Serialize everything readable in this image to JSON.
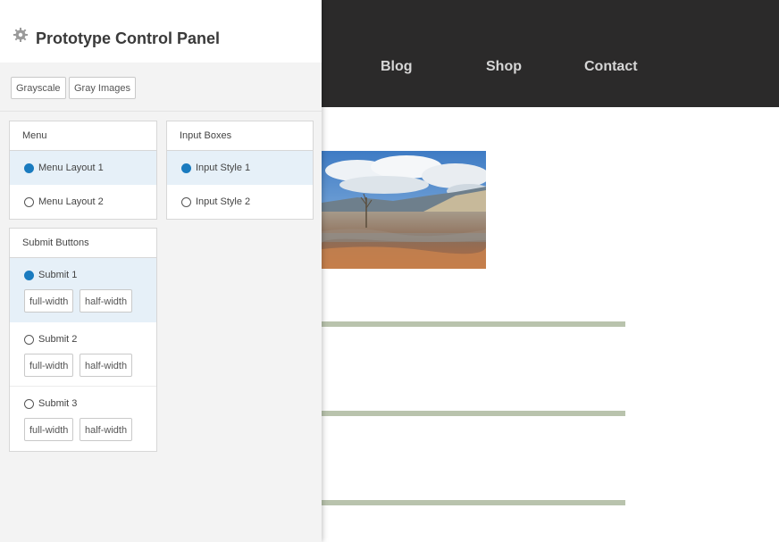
{
  "site": {
    "nav": [
      "Blog",
      "Shop",
      "Contact"
    ]
  },
  "panel": {
    "title": "Prototype Control Panel",
    "gear_icon": "gear-icon",
    "top_buttons": [
      "Grayscale",
      "Gray Images"
    ],
    "menu": {
      "heading": "Menu",
      "options": [
        "Menu Layout 1",
        "Menu Layout 2"
      ],
      "selected": 0
    },
    "input_boxes": {
      "heading": "Input Boxes",
      "options": [
        "Input Style 1",
        "Input Style 2"
      ],
      "selected": 0
    },
    "submit_buttons": {
      "heading": "Submit Buttons",
      "items": [
        {
          "label": "Submit 1",
          "full": "full-width",
          "half": "half-width"
        },
        {
          "label": "Submit 2",
          "full": "full-width",
          "half": "half-width"
        },
        {
          "label": "Submit 3",
          "full": "full-width",
          "half": "half-width"
        }
      ],
      "selected": 0
    }
  },
  "colors": {
    "header_bg": "#2b2a2a",
    "accent": "#1a7bbf",
    "selected_bg": "#e6f0f8",
    "divider": "#b9c3ad"
  }
}
